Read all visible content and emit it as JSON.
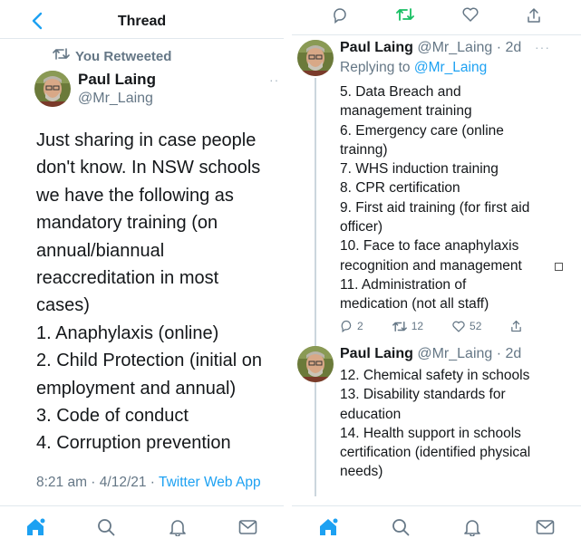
{
  "left": {
    "header": {
      "title": "Thread",
      "back_icon": "back-arrow-icon"
    },
    "retweet_label": "You Retweeted",
    "tweet": {
      "author_name": "Paul Laing",
      "author_handle": "@Mr_Laing",
      "more": "··",
      "body": "Just sharing in case people don't know. In NSW schools we have the following as mandatory training (on annual/biannual reaccreditation in most cases)\n1. Anaphylaxis (online)\n2. Child Protection (initial on employment and annual)\n3. Code of conduct\n4. Corruption prevention",
      "timestamp": "8:21 am · 4/12/21 ·",
      "source_app": "Twitter Web App"
    }
  },
  "right": {
    "top_actions": [
      "reply-icon",
      "retweet-icon",
      "like-icon",
      "share-icon"
    ],
    "tweets": [
      {
        "author_name": "Paul Laing",
        "author_handle": "@Mr_Laing",
        "time": "2d",
        "more": "···",
        "replying_label": "Replying to",
        "replying_to": "@Mr_Laing",
        "body": "5. Data Breach and\nmanagement training\n6. Emergency care (online\ntrainng)\n7. WHS induction training\n8. CPR certification\n9. First aid training (for first aid\nofficer)\n10. Face to face anaphylaxis\nrecognition and management\n11. Administration of\nmedication (not all staff)",
        "replies": "2",
        "retweets": "12",
        "likes": "52"
      },
      {
        "author_name": "Paul Laing",
        "author_handle": "@Mr_Laing",
        "time": "2d",
        "body": "12. Chemical safety in schools\n13. Disability standards for\neducation\n14. Health support in schools\ncertification (identified physical\nneeds)"
      }
    ]
  },
  "tabbar": [
    "home-icon",
    "search-icon",
    "notifications-icon",
    "messages-icon"
  ],
  "colors": {
    "accent": "#1da1f2",
    "retweet_green": "#17bf63",
    "muted": "#657786",
    "text": "#14171a"
  }
}
